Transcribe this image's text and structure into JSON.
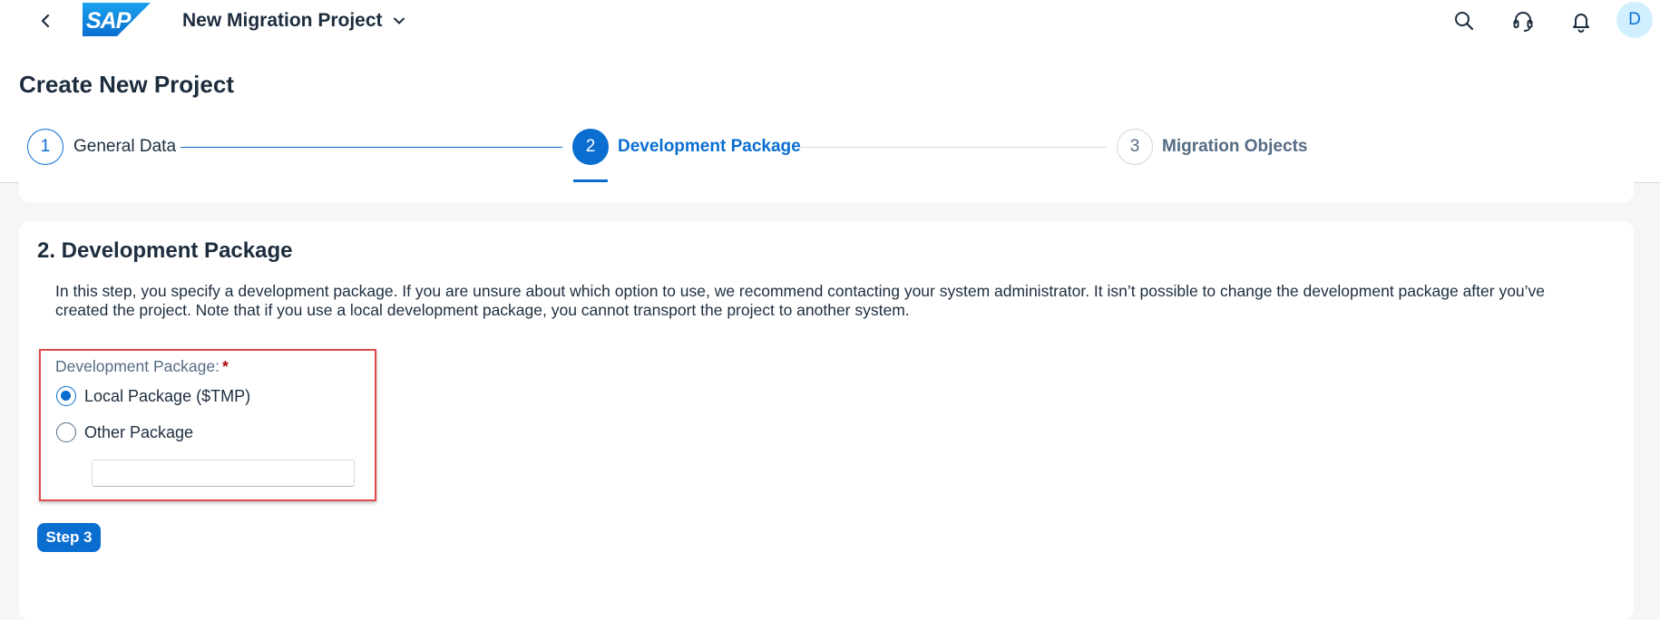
{
  "shell": {
    "app_title": "New Migration Project",
    "logo_text": "SAP",
    "avatar_initial": "D",
    "icons": [
      "back-icon",
      "chevron-down-icon",
      "search-icon",
      "headset-icon",
      "bell-icon"
    ]
  },
  "page": {
    "title": "Create New Project"
  },
  "wizard": {
    "steps": [
      {
        "number": "1",
        "label": "General Data",
        "state": "completed"
      },
      {
        "number": "2",
        "label": "Development Package",
        "state": "active"
      },
      {
        "number": "3",
        "label": "Migration Objects",
        "state": "upcoming"
      }
    ]
  },
  "section": {
    "title": "2. Development Package",
    "description": "In this step, you specify a development package. If you are unsure about which option to use, we recommend contacting your system administrator. It isn’t possible to change the development package after you’ve created the project. Note that if you use a local development package, you cannot transport the project to another system.",
    "field_label": "Development Package:",
    "required_marker": "*",
    "options": [
      {
        "label": "Local Package ($TMP)",
        "selected": true
      },
      {
        "label": "Other Package",
        "selected": false
      }
    ],
    "other_package_value": ""
  },
  "actions": {
    "next_step_label": "Step 3"
  },
  "colors": {
    "accent": "#0a6ed1",
    "highlight_border": "#e04b4b",
    "required": "#aa0808",
    "avatar_bg": "#d1efff"
  }
}
